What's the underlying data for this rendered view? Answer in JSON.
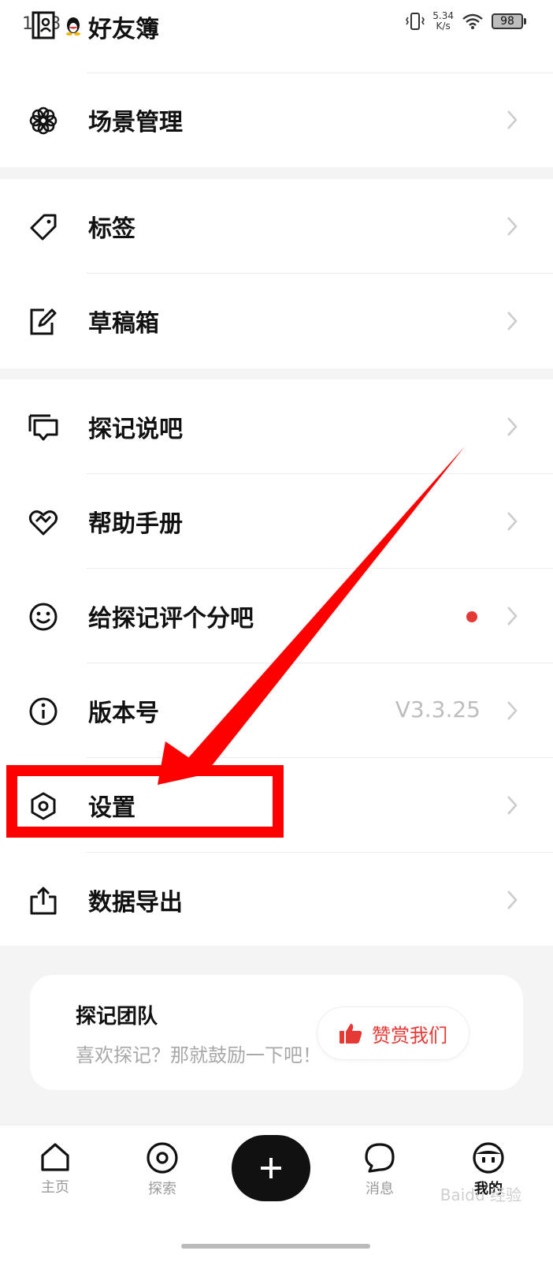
{
  "status_bar": {
    "time": "1:33",
    "title": "好友簿",
    "speed_value": "5.34",
    "speed_unit": "K/s",
    "battery": "98"
  },
  "menu": {
    "scene": "场景管理",
    "tags": "标签",
    "drafts": "草稿箱",
    "talk": "探记说吧",
    "help": "帮助手册",
    "rate": "给探记评个分吧",
    "version_label": "版本号",
    "version_value": "V3.3.25",
    "settings": "设置",
    "export": "数据导出"
  },
  "team": {
    "title": "探记团队",
    "subtitle": "喜欢探记？那就鼓励一下吧！",
    "reward_label": "赞赏我们"
  },
  "nav": {
    "home": "主页",
    "explore": "探索",
    "messages": "消息",
    "mine": "我的"
  },
  "watermark": "Baidu 经验"
}
